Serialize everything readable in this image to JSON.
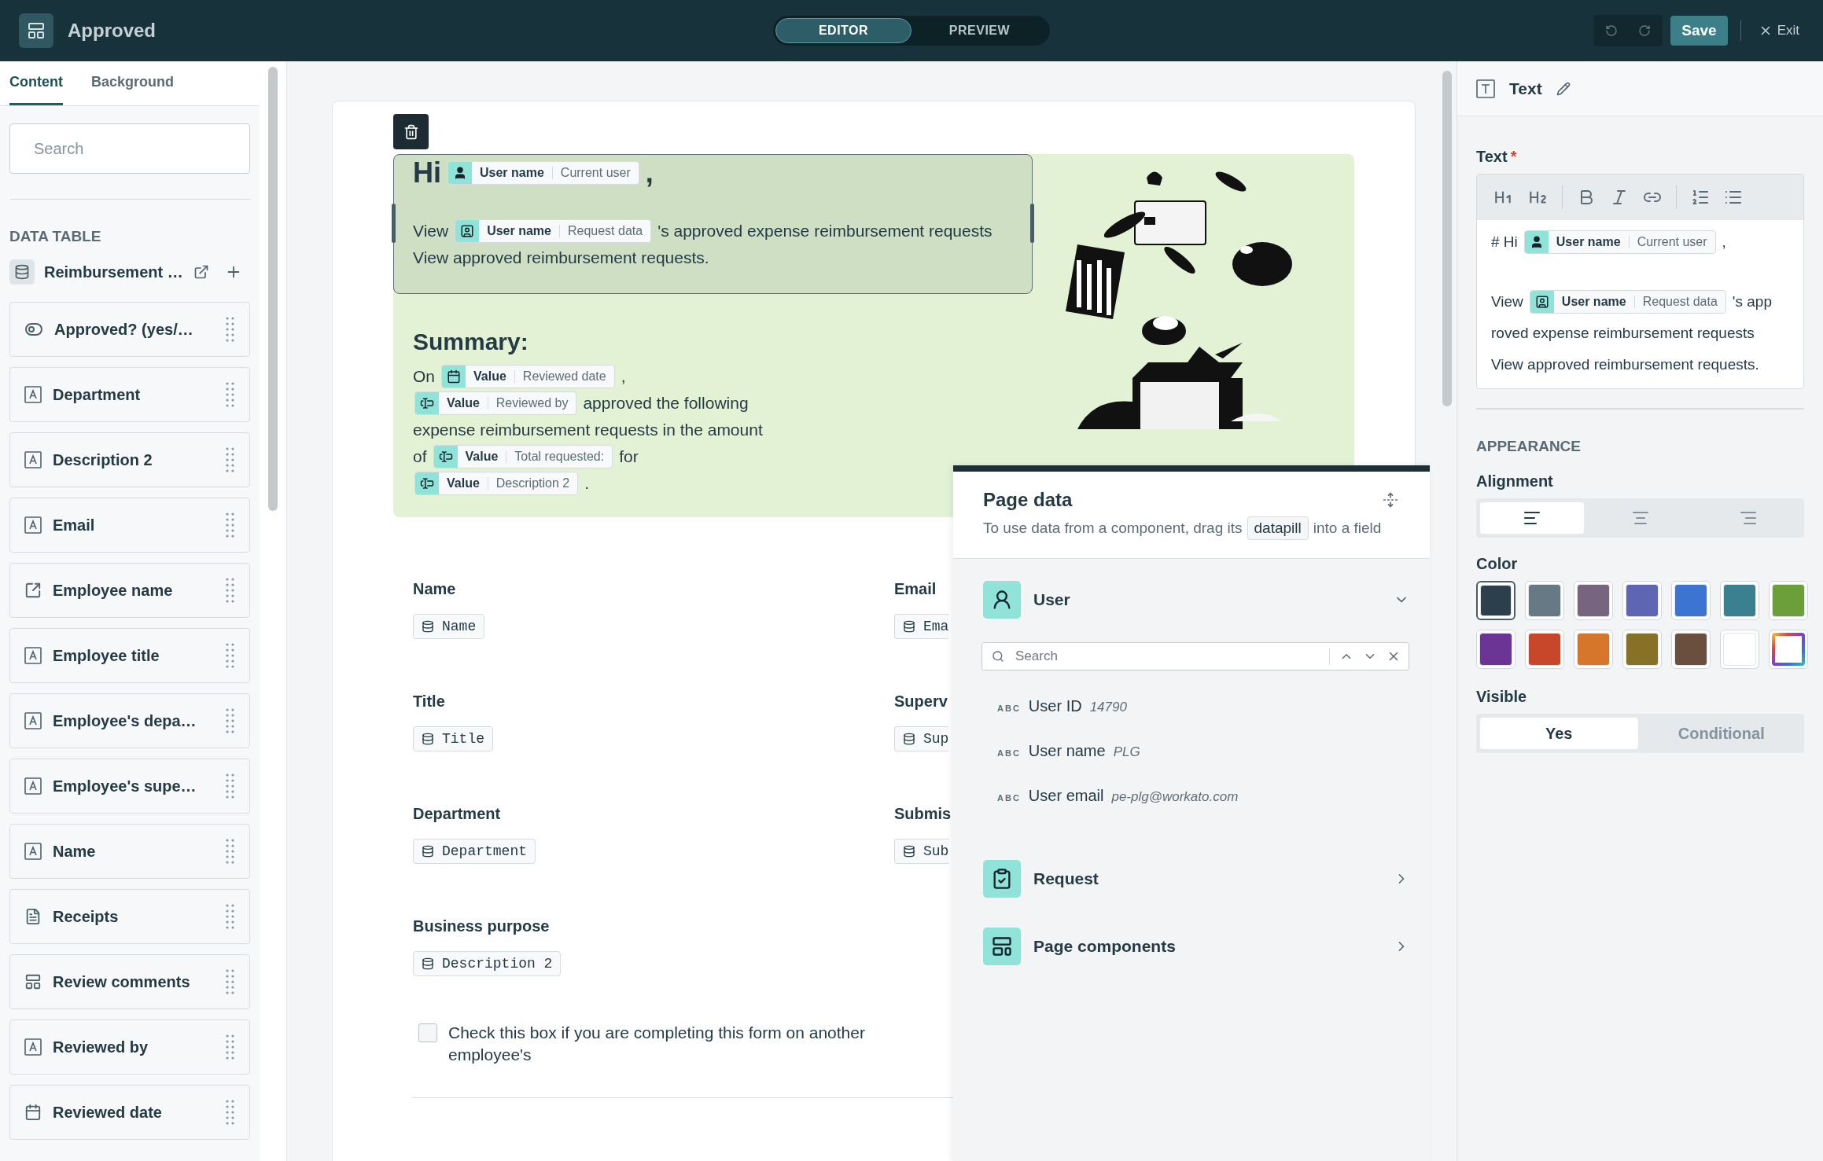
{
  "app_bar": {
    "title": "Approved",
    "modes": [
      {
        "label": "EDITOR",
        "selected": true
      },
      {
        "label": "PREVIEW",
        "selected": false
      }
    ],
    "save": "Save",
    "exit": "Exit"
  },
  "left_panel": {
    "tabs": [
      {
        "label": "Content",
        "selected": true
      },
      {
        "label": "Background",
        "selected": false
      }
    ],
    "search": {
      "placeholder": "Search"
    },
    "section": "DATA TABLE",
    "table_name": "Reimbursement …",
    "fields": [
      {
        "label": "Approved? (yes/…",
        "kind": "toggle"
      },
      {
        "label": "Department",
        "kind": "text"
      },
      {
        "label": "Description 2",
        "kind": "text"
      },
      {
        "label": "Email",
        "kind": "text"
      },
      {
        "label": "Employee name",
        "kind": "reference"
      },
      {
        "label": "Employee title",
        "kind": "text"
      },
      {
        "label": "Employee's depa…",
        "kind": "text"
      },
      {
        "label": "Employee's supe…",
        "kind": "text"
      },
      {
        "label": "Name",
        "kind": "text"
      },
      {
        "label": "Receipts",
        "kind": "file"
      },
      {
        "label": "Review comments",
        "kind": "longtext"
      },
      {
        "label": "Reviewed by",
        "kind": "text"
      },
      {
        "label": "Reviewed date",
        "kind": "date"
      }
    ]
  },
  "hero": {
    "heading": [
      {
        "kind": "text",
        "text": "Hi"
      },
      {
        "kind": "user",
        "label": "User name",
        "source": "Current user"
      },
      {
        "kind": "text",
        "text": ","
      }
    ],
    "lines": [
      [
        {
          "kind": "text",
          "text": "View"
        },
        {
          "kind": "badge",
          "label": "User name",
          "source": "Request data"
        },
        {
          "kind": "text",
          "text": "'s approved expense reimbursement requests"
        }
      ],
      [
        {
          "kind": "text",
          "text": "View approved reimbursement requests."
        }
      ]
    ],
    "summary_title": "Summary:",
    "summary": [
      [
        {
          "kind": "text",
          "text": "On"
        },
        {
          "kind": "date",
          "label": "Value",
          "source": "Reviewed date"
        },
        {
          "kind": "text",
          "text": ","
        }
      ],
      [
        {
          "kind": "field",
          "label": "Value",
          "source": "Reviewed by"
        },
        {
          "kind": "text",
          "text": "approved the following"
        }
      ],
      [
        {
          "kind": "text",
          "text": "expense reimbursement requests in the amount"
        }
      ],
      [
        {
          "kind": "text",
          "text": "of"
        },
        {
          "kind": "field",
          "label": "Value",
          "source": "Total requested:"
        },
        {
          "kind": "text",
          "text": "for"
        }
      ],
      [
        {
          "kind": "field",
          "label": "Value",
          "source": "Description 2"
        },
        {
          "kind": "text",
          "text": "."
        }
      ]
    ]
  },
  "form": {
    "fields": [
      {
        "label": "Name",
        "value": "Name"
      },
      {
        "label": "Email",
        "value": "Ema"
      },
      {
        "label": "Title",
        "value": "Title"
      },
      {
        "label": "Superv",
        "value": "Sup"
      },
      {
        "label": "Department",
        "value": "Department"
      },
      {
        "label": "Submis",
        "value": "Sub"
      },
      {
        "label": "Business purpose",
        "value": "Description 2"
      }
    ],
    "checkbox": {
      "label": "Check this box if you are completing this form on another employee's",
      "checked": false
    }
  },
  "page_data": {
    "title": "Page data",
    "description": [
      {
        "kind": "text",
        "text": "To use data from a component, drag its"
      },
      {
        "kind": "chip",
        "text": "datapill"
      },
      {
        "kind": "text",
        "text": "into a field"
      }
    ],
    "groups": [
      {
        "title": "User",
        "kind": "user",
        "expanded": true,
        "search": {
          "placeholder": "Search"
        },
        "items": [
          {
            "type": "ABC",
            "label": "User ID",
            "value": "14790"
          },
          {
            "type": "ABC",
            "label": "User name",
            "value": "PLG"
          },
          {
            "type": "ABC",
            "label": "User email",
            "value": "pe-plg@workato.com"
          }
        ]
      },
      {
        "title": "Request",
        "kind": "request",
        "expanded": false
      },
      {
        "title": "Page components",
        "kind": "components",
        "expanded": false
      }
    ]
  },
  "right_panel": {
    "title": "Text",
    "field_label": "Text",
    "required": "*",
    "editor": [
      [
        {
          "kind": "text",
          "text": "# Hi"
        },
        {
          "kind": "user",
          "label": "User name",
          "source": "Current user"
        },
        {
          "kind": "text",
          "text": ","
        }
      ],
      [
        {
          "kind": "text",
          "text": "View"
        },
        {
          "kind": "badge",
          "label": "User name",
          "source": "Request data"
        },
        {
          "kind": "text",
          "text": "'s app"
        }
      ],
      [
        {
          "kind": "text",
          "text": "roved expense reimbursement requests"
        }
      ],
      [
        {
          "kind": "text",
          "text": "View approved reimbursement requests."
        }
      ]
    ],
    "appearance": "APPEARANCE",
    "alignment_label": "Alignment",
    "alignment": [
      {
        "kind": "left",
        "selected": true
      },
      {
        "kind": "center",
        "selected": false
      },
      {
        "kind": "right",
        "selected": false
      }
    ],
    "color_label": "Color",
    "colors": [
      {
        "kind": "solid",
        "color": "#2b3f4c",
        "selected": true
      },
      {
        "kind": "solid",
        "color": "#677985",
        "selected": false
      },
      {
        "kind": "solid",
        "color": "#77657f",
        "selected": false
      },
      {
        "kind": "solid",
        "color": "#5e66b3",
        "selected": false
      },
      {
        "kind": "solid",
        "color": "#3b74d1",
        "selected": false
      },
      {
        "kind": "solid",
        "color": "#3a8090",
        "selected": false
      },
      {
        "kind": "solid",
        "color": "#6a9f3a",
        "selected": false
      },
      {
        "kind": "solid",
        "color": "#6c3494",
        "selected": false
      },
      {
        "kind": "solid",
        "color": "#c8472a",
        "selected": false
      },
      {
        "kind": "solid",
        "color": "#d6762b",
        "selected": false
      },
      {
        "kind": "solid",
        "color": "#877126",
        "selected": false
      },
      {
        "kind": "solid",
        "color": "#6b4f3e",
        "selected": false
      },
      {
        "kind": "solid",
        "color": "#ffffff",
        "selected": false
      },
      {
        "kind": "custom",
        "selected": false
      }
    ],
    "visible_label": "Visible",
    "visible": [
      {
        "label": "Yes",
        "selected": true
      },
      {
        "label": "Conditional",
        "selected": false
      }
    ]
  }
}
